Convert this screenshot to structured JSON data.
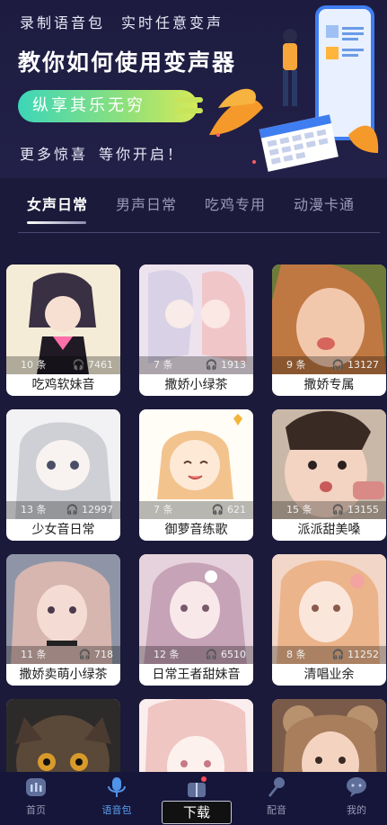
{
  "banner": {
    "line1_a": "录制语音包",
    "line1_b": "实时任意变声",
    "title": "教你如何使用变声器",
    "pill": "纵享其乐无穷",
    "line3_a": "更多惊喜",
    "line3_b": "等你开启！"
  },
  "tabs": [
    "女声日常",
    "男声日常",
    "吃鸡专用",
    "动漫卡通"
  ],
  "active_tab": "女声日常",
  "cards": [
    {
      "count": "10 条",
      "plays": "7461",
      "name": "吃鸡软妹音"
    },
    {
      "count": "7 条",
      "plays": "1913",
      "name": "撒娇小绿茶"
    },
    {
      "count": "9 条",
      "plays": "13127",
      "name": "撒娇专属"
    },
    {
      "count": "13 条",
      "plays": "12997",
      "name": "少女音日常"
    },
    {
      "count": "7 条",
      "plays": "621",
      "name": "御萝音练歌"
    },
    {
      "count": "15 条",
      "plays": "13155",
      "name": "派派甜美嗓"
    },
    {
      "count": "11 条",
      "plays": "718",
      "name": "撒娇卖萌小绿茶"
    },
    {
      "count": "12 条",
      "plays": "6510",
      "name": "日常王者甜妹音"
    },
    {
      "count": "8 条",
      "plays": "11252",
      "name": "清唱业余"
    },
    {
      "count": "",
      "plays": "",
      "name": ""
    },
    {
      "count": "",
      "plays": "",
      "name": ""
    },
    {
      "count": "",
      "plays": "",
      "name": ""
    }
  ],
  "nav": {
    "home": "首页",
    "voicepack": "语音包",
    "dub": "配音",
    "mine": "我的",
    "download": "下载"
  },
  "colors": {
    "background": "#1b1a3a",
    "nav_active": "#5aa2f0",
    "pill_gradient_start": "#3dd6b8",
    "pill_gradient_end": "#d6ea5a"
  }
}
